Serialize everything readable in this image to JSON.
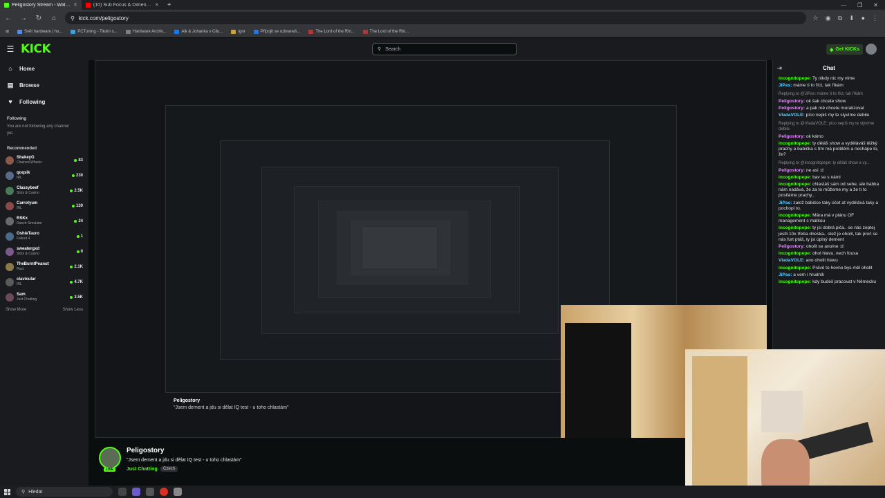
{
  "browser": {
    "tabs": [
      {
        "title": "Peligostory Stream - Watch Liv",
        "active": true,
        "color": "#53fc18"
      },
      {
        "title": "(10) Sub Focus & Dimensio",
        "active": false,
        "color": "#ff0000"
      }
    ],
    "new_tab": "+",
    "url": "kick.com/peligostory",
    "bookmarks": [
      "Svět hardware | ho...",
      "PCTuning - Titulní s...",
      "Hardware Archiv...",
      "Aik & Johanka v Cilu...",
      "Igor",
      "Připojit se ozbraneš...",
      "The Lord of the Rin...",
      "The Lord of the Rin..."
    ]
  },
  "kick": {
    "logo": "KICK",
    "search_placeholder": "Search",
    "get_kicks": "Get KICKs"
  },
  "sidebar": {
    "nav": [
      {
        "label": "Home",
        "icon": "home-icon"
      },
      {
        "label": "Browse",
        "icon": "browse-icon"
      },
      {
        "label": "Following",
        "icon": "heart-icon"
      }
    ],
    "following_title": "Following",
    "not_following": "You are not following any channel yet.",
    "recommended_title": "Recommended",
    "recommended": [
      {
        "name": "ShakeyG",
        "category": "Chained Wheels",
        "viewers": "83"
      },
      {
        "name": "qoqsik",
        "category": "IRL",
        "viewers": "230"
      },
      {
        "name": "Classybeef",
        "category": "Slots & Casino",
        "viewers": "2.5K"
      },
      {
        "name": "Carrotyum",
        "category": "IRL",
        "viewers": "130"
      },
      {
        "name": "RSKx",
        "category": "Ranch Simulator",
        "viewers": "24"
      },
      {
        "name": "OshieTauro",
        "category": "Fallout 4",
        "viewers": "1"
      },
      {
        "name": "sweatergxd",
        "category": "Slots & Casino",
        "viewers": "0"
      },
      {
        "name": "TheBurntPeanut",
        "category": "Rust",
        "viewers": "2.1K"
      },
      {
        "name": "clavicular",
        "category": "IRL",
        "viewers": "4.7K"
      },
      {
        "name": "Sam",
        "category": "Just Chatting",
        "viewers": "3.5K"
      }
    ],
    "show_more": "Show More",
    "show_less": "Show Less"
  },
  "chat": {
    "title": "Chat",
    "messages": [
      {
        "user": "incognitopepe:",
        "color": "#53fc18",
        "text": " Ty nikdy nic my víme",
        "reply": ""
      },
      {
        "user": "JiPas:",
        "color": "#5fd1ff",
        "text": " máme ti to říct, tak říkám",
        "reply": ""
      },
      {
        "user": "",
        "color": "#8a9097",
        "text": "Replying to @JiPas: máme ti to říct, tak říkám",
        "reply": "yes"
      },
      {
        "user": "Peligostory:",
        "color": "#e58bff",
        "text": " ok šak chcete show",
        "reply": ""
      },
      {
        "user": "Peligostory:",
        "color": "#e58bff",
        "text": " a pak mě chcete moralizovat",
        "reply": ""
      },
      {
        "user": "VladaVOLE:",
        "color": "#5fd1ff",
        "text": " píco nepiš my te slyvíme debile",
        "reply": ""
      },
      {
        "user": "",
        "color": "#8a9097",
        "text": "Replying to @VladaVOLE: píco nepiš my te slyvíme debile",
        "reply": "yes"
      },
      {
        "user": "Peligostory:",
        "color": "#e58bff",
        "text": " ok kámo",
        "reply": ""
      },
      {
        "user": "incognitopepe:",
        "color": "#53fc18",
        "text": " ty děláš show a vyděláváš těžký prachy a babička s tím má problém a nechápe to, že?",
        "reply": ""
      },
      {
        "user": "",
        "color": "#8a9097",
        "text": "Replying to @incognitopepe: ty děláš show a vy...",
        "reply": "yes"
      },
      {
        "user": "Peligostory:",
        "color": "#e58bff",
        "text": " ne asi :d",
        "reply": ""
      },
      {
        "user": "incognitopepe:",
        "color": "#53fc18",
        "text": " bav se s námi",
        "reply": ""
      },
      {
        "user": "incognitopepe:",
        "color": "#53fc18",
        "text": " chlastáš sám od sebe, ale babka nám nadává, že za to můžeme my a že ti to posíláme prachy..",
        "reply": ""
      },
      {
        "user": "JiPas:",
        "color": "#5fd1ff",
        "text": " založ babičce taky účet at vydělává taky a pochopí to.",
        "reply": ""
      },
      {
        "user": "incognitopepe:",
        "color": "#53fc18",
        "text": " Mára má v plánu OF management s matkou",
        "reply": ""
      },
      {
        "user": "incognitopepe:",
        "color": "#53fc18",
        "text": " ty jsi dobrá piča.. se nás zeptej jestli 10x třeba dneska.. stež je oholil, tak proč se nás furt ptáš, ty jsi úplný dement",
        "reply": ""
      },
      {
        "user": "Peligostory:",
        "color": "#e58bff",
        "text": " oholit se ano/ne :d",
        "reply": ""
      },
      {
        "user": "incognitopepe:",
        "color": "#53fc18",
        "text": " ohol hlavu, nech fousa",
        "reply": ""
      },
      {
        "user": "VladaVOLE:",
        "color": "#5fd1ff",
        "text": " ano oholit hlavu",
        "reply": ""
      },
      {
        "user": "incognitopepe:",
        "color": "#53fc18",
        "text": " Právě to hovno bys měl oholit",
        "reply": ""
      },
      {
        "user": "JiPas:",
        "color": "#5fd1ff",
        "text": " a vem i hrudník",
        "reply": ""
      },
      {
        "user": "incognitopepe:",
        "color": "#53fc18",
        "text": " kdy budeš pracovat v Německu",
        "reply": ""
      }
    ]
  },
  "stream": {
    "streamer": "Peligostory",
    "title": "\"Jsem dement a jdu si dělat IQ test - u toho chlastám\"",
    "category": "Just Chatting",
    "tag": "Czech",
    "live_badge": "LIVE"
  },
  "taskbar": {
    "search": "Hledat"
  }
}
